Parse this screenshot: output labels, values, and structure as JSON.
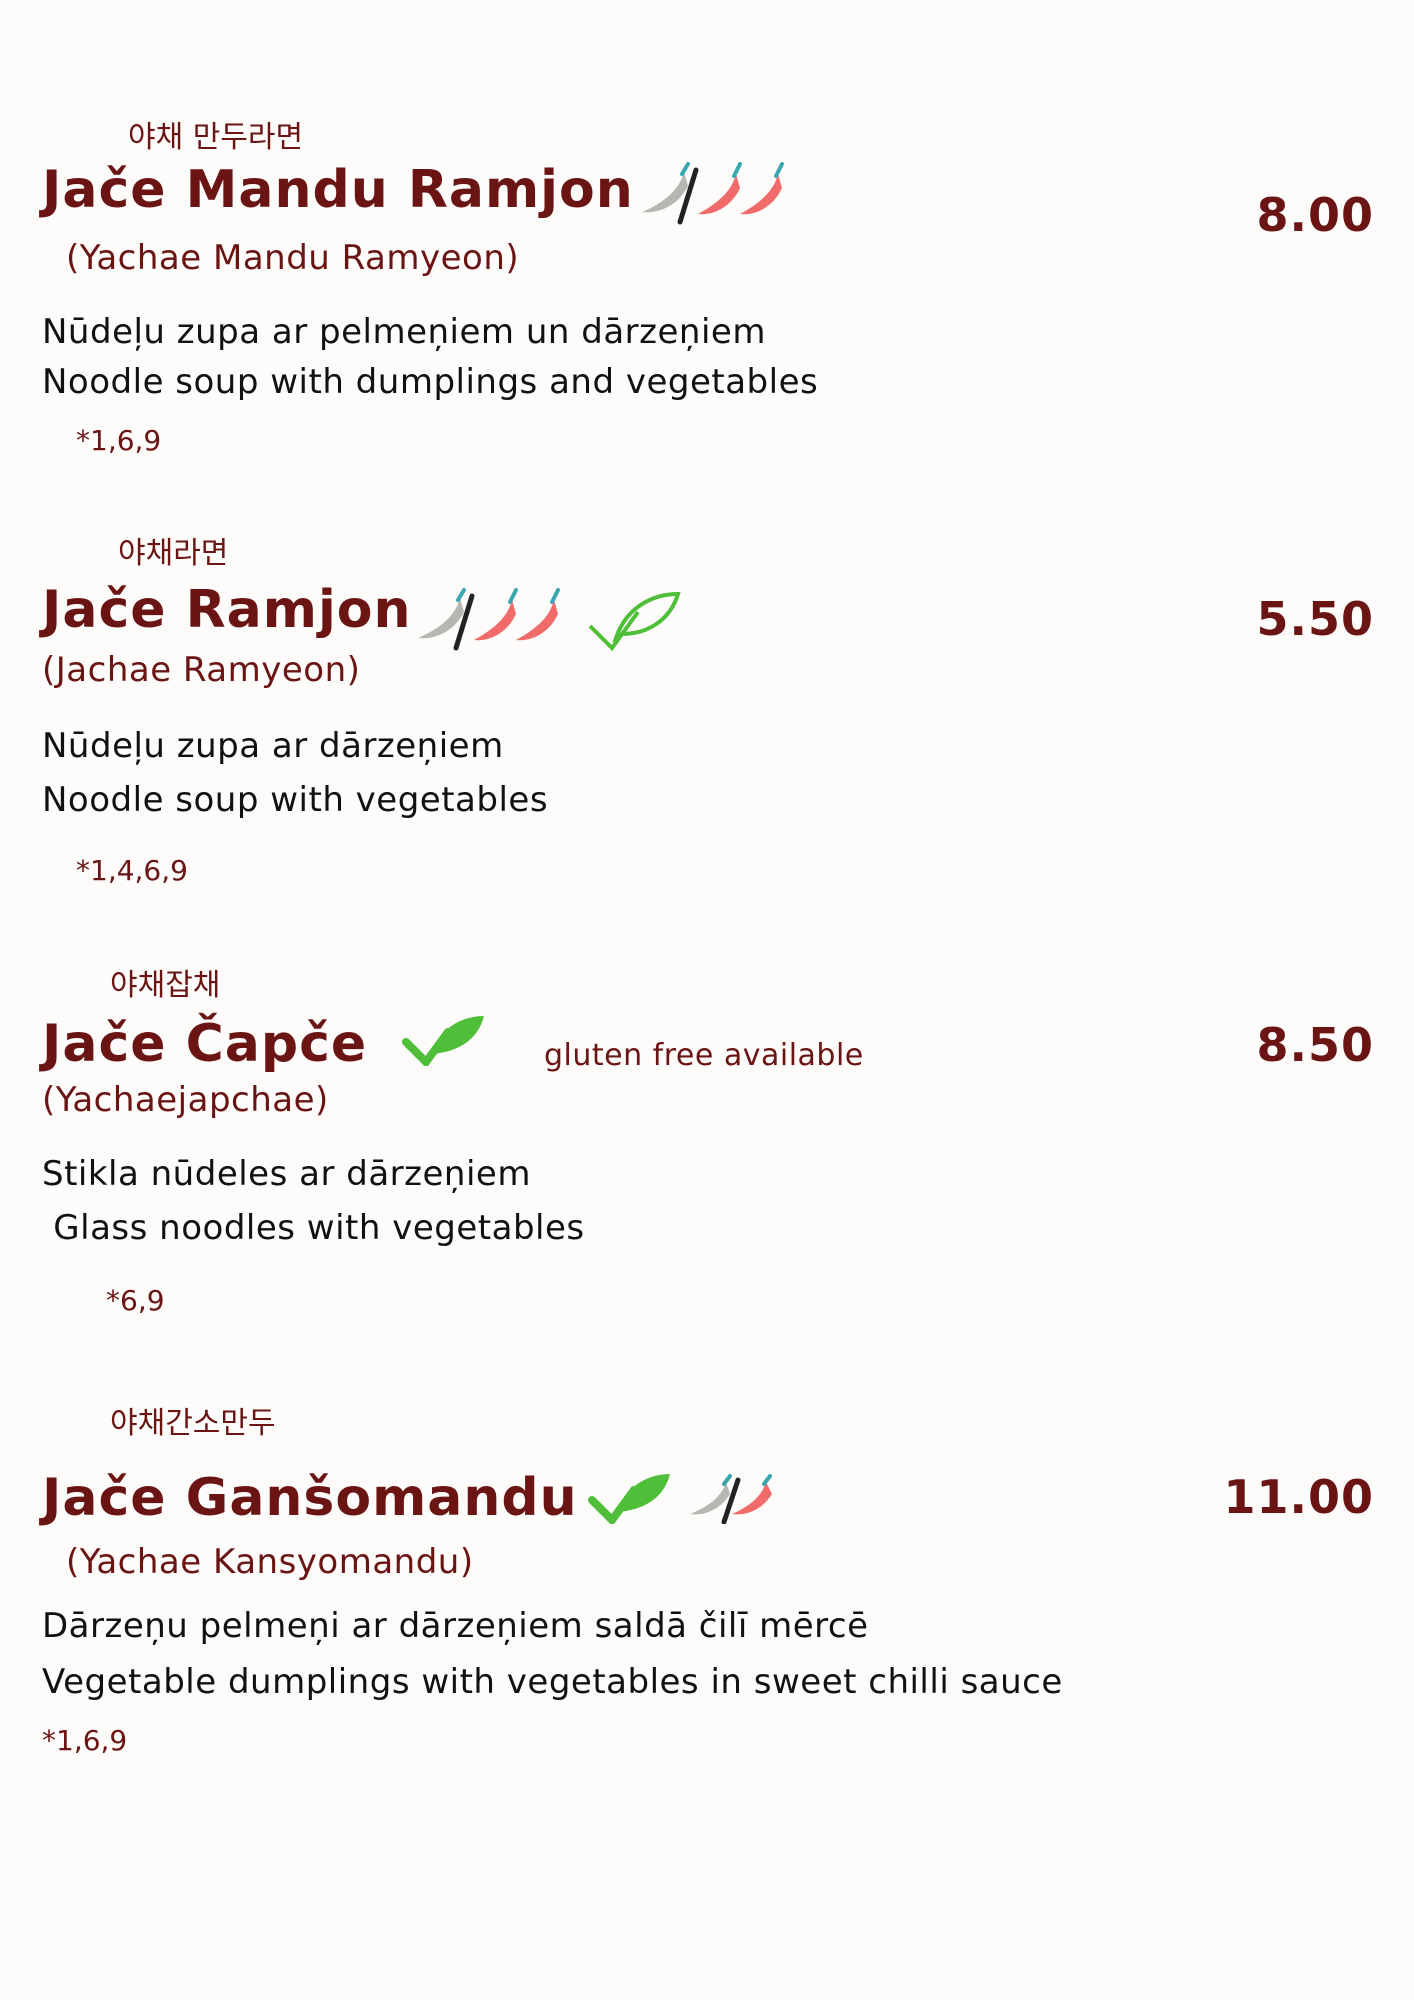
{
  "colors": {
    "accent": "#6b1414",
    "text": "#111111",
    "vegan": "#4fbf3a",
    "chili_hot": "#f26b6b",
    "chili_mild": "#b8b6b0"
  },
  "items": [
    {
      "korean": "야채 만두라면",
      "name": "Jače Mandu Ramjon",
      "romanized": "(Yachae Mandu Ramyeon)",
      "desc_lv": "Nūdeļu zupa ar pelmeņiem un dārzeņiem",
      "desc_en": "Noodle soup with dumplings and vegetables",
      "allergens": "*1,6,9",
      "price": "8.00",
      "icons": [
        "chili-mild-or-hot-icon"
      ]
    },
    {
      "korean": "야채라면",
      "name": "Jače Ramjon",
      "romanized": "(Jachae Ramyeon)",
      "desc_lv": "Nūdeļu zupa ar dārzeņiem",
      "desc_en": "Noodle soup with vegetables",
      "allergens": "*1,4,6,9",
      "price": "5.50",
      "icons": [
        "chili-mild-or-hot-icon",
        "vegan-leaf-icon"
      ]
    },
    {
      "korean": "야채잡채",
      "name": "Jače Čapče",
      "romanized": "(Yachaejapchae)",
      "desc_lv": "Stikla nūdeles ar dārzeņiem",
      "desc_en": " Glass noodles with vegetables",
      "allergens": "*6,9",
      "price": "8.50",
      "note": "gluten free available",
      "icons": [
        "vegan-leaf-icon"
      ]
    },
    {
      "korean": "야채간소만두",
      "name": "Jače Ganšomandu",
      "romanized": "(Yachae Kansyomandu)",
      "desc_lv": "Dārzeņu pelmeņi ar dārzeņiem saldā čilī mērcē",
      "desc_en": "Vegetable dumplings with vegetables in sweet chilli sauce",
      "allergens": "*1,6,9",
      "price": "11.00",
      "icons": [
        "vegan-leaf-icon",
        "chili-mild-or-hot-icon"
      ]
    }
  ]
}
